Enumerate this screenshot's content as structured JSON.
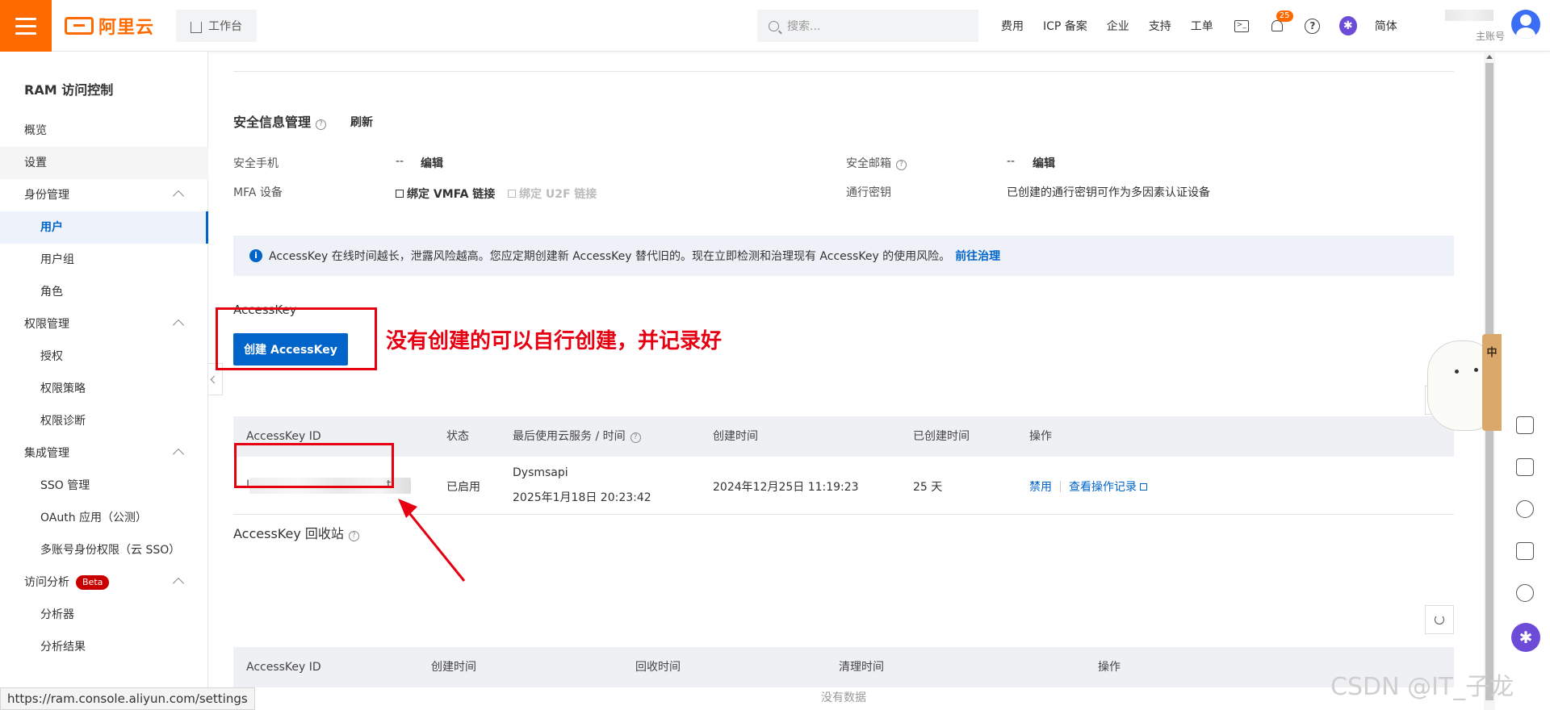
{
  "header": {
    "logo_text": "阿里云",
    "workbench_label": "工作台",
    "search_placeholder": "搜索...",
    "nav": [
      "费用",
      "ICP 备案",
      "企业",
      "支持",
      "工单"
    ],
    "notification_count": "25",
    "help_glyph": "?",
    "assistant_glyph": "✱",
    "language": "简体",
    "account_type": "主账号"
  },
  "sidebar": {
    "title": "RAM 访问控制",
    "items": [
      {
        "label": "概览"
      },
      {
        "label": "设置"
      },
      {
        "label": "身份管理"
      },
      {
        "label": "用户"
      },
      {
        "label": "用户组"
      },
      {
        "label": "角色"
      },
      {
        "label": "权限管理"
      },
      {
        "label": "授权"
      },
      {
        "label": "权限策略"
      },
      {
        "label": "权限诊断"
      },
      {
        "label": "集成管理"
      },
      {
        "label": "SSO 管理"
      },
      {
        "label": "OAuth 应用（公测）"
      },
      {
        "label": "多账号身份权限（云 SSO）"
      },
      {
        "label": "访问分析"
      },
      {
        "label": "分析器"
      },
      {
        "label": "分析结果"
      }
    ],
    "beta_badge": "Beta"
  },
  "security": {
    "title": "安全信息管理",
    "refresh": "刷新",
    "phone_label": "安全手机",
    "phone_value": "--",
    "phone_edit": "编辑",
    "email_label": "安全邮箱",
    "email_value": "--",
    "email_edit": "编辑",
    "mfa_label": "MFA 设备",
    "mfa_vmfa": "绑定 VMFA 链接",
    "mfa_u2f": "绑定 U2F 链接",
    "passkey_label": "通行密钥",
    "passkey_value": "已创建的通行密钥可作为多因素认证设备"
  },
  "notice": {
    "info_glyph": "i",
    "text": "AccessKey 在线时间越长，泄露风险越高。您应定期创建新 AccessKey 替代旧的。现在立即检测和治理现有 AccessKey 的使用风险。",
    "link": "前往治理"
  },
  "accesskey": {
    "title": "AccessKey",
    "create_button": "创建 AccessKey",
    "annotation": "没有创建的可以自行创建，并记录好",
    "columns": [
      "AccessKey ID",
      "状态",
      "最后使用云服务 / 时间",
      "创建时间",
      "已创建时间",
      "操作"
    ],
    "rows": [
      {
        "id_prefix": "L",
        "id_suffix": "t",
        "status": "已启用",
        "last_service": "Dysmsapi",
        "last_time": "2025年1月18日 20:23:42",
        "created": "2024年12月25日 11:19:23",
        "age": "25 天",
        "action_disable": "禁用",
        "action_log": "查看操作记录"
      }
    ]
  },
  "recycle": {
    "title": "AccessKey 回收站",
    "columns": [
      "AccessKey ID",
      "创建时间",
      "回收时间",
      "清理时间",
      "操作"
    ],
    "empty": "没有数据"
  },
  "mascot_tab": "中",
  "statusbar": "https://ram.console.aliyun.com/settings",
  "watermark": "CSDN @IT_子龙",
  "colors": {
    "brand": "#ff6a00",
    "link": "#0064c8",
    "annotation": "#e60012"
  }
}
